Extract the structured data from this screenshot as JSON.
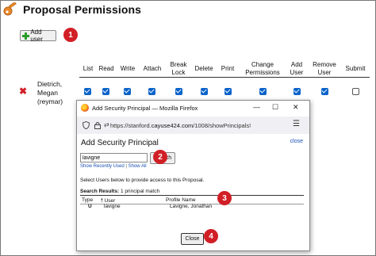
{
  "page": {
    "title": "Proposal Permissions",
    "add_user_label": "Add user"
  },
  "callouts": [
    "1",
    "2",
    "3",
    "4"
  ],
  "permissions_table": {
    "columns": [
      "List",
      "Read",
      "Write",
      "Attach",
      "Break Lock",
      "Delete",
      "Print",
      "Change Permissions",
      "Add User",
      "Remove User",
      "Submit"
    ],
    "rows": [
      {
        "user": "Dietrich, Megan (reymar)",
        "checked": [
          true,
          true,
          true,
          true,
          true,
          true,
          true,
          true,
          true,
          true,
          false
        ]
      }
    ]
  },
  "popup": {
    "window_title": "Add Security Principal — Mozilla Firefox",
    "url_prefix": "https://stanford.",
    "url_host": "cayuse424.com",
    "url_path": "/1008/showPrincipals!",
    "heading": "Add Security Principal",
    "close_link": "close",
    "search_value": "lavigne",
    "search_button": "Search",
    "show_recently_used": "Show Recently Used",
    "link_separator": "|",
    "show_all": "Show All",
    "instruction": "Select Users below to provide access to this Proposal.",
    "results_label": "Search Results:",
    "results_count": "1 principal match",
    "result_columns": [
      "Type",
      "User",
      "Profile Name"
    ],
    "results": [
      {
        "type": "U",
        "user": "lavigne",
        "profile_name": "Lavigne, Jonathan"
      }
    ],
    "close_button": "Close"
  },
  "colors": {
    "callout": "#d11f26",
    "checkbox": "#0a63c9",
    "link": "#1a4fb3",
    "add_icon": "#2a9b2a"
  },
  "icons": [
    "key-icon",
    "plus-icon",
    "delete-icon",
    "firefox-icon",
    "shield-icon",
    "lock-icon",
    "permissions-icon",
    "menu-icon",
    "minimize-icon",
    "maximize-icon",
    "close-window-icon",
    "sort-up-icon"
  ]
}
